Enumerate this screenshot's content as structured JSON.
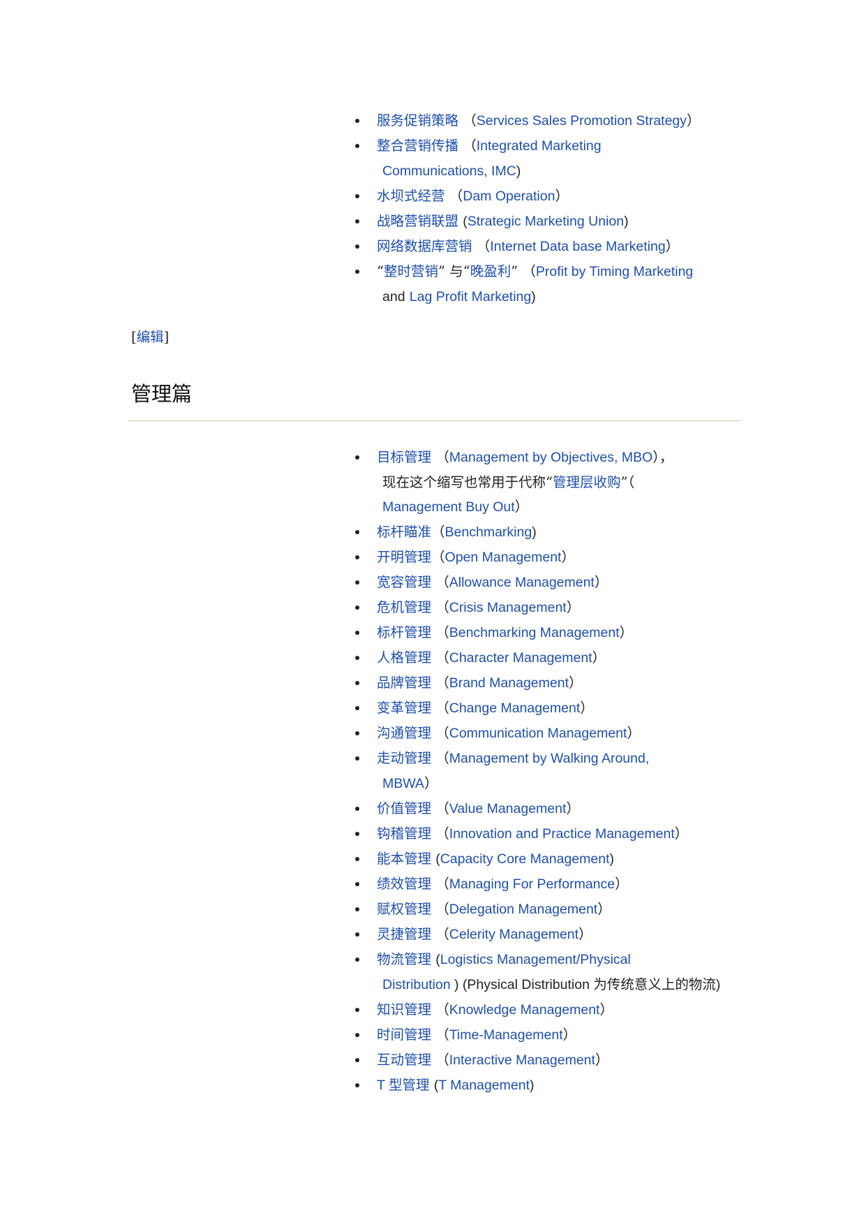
{
  "marketing_items": [
    {
      "zh": "服务促销策略",
      "sep": "（",
      "en": "Services Sales Promotion Strategy",
      "close": "）"
    },
    {
      "zh": "整合营销传播",
      "sep": "（",
      "en": "Integrated Marketing",
      "en2": "Communications, IMC",
      "close": ")"
    },
    {
      "zh": "水坝式经营",
      "sep": "（",
      "en": "Dam Operation",
      "close": "）"
    },
    {
      "zh": "战略营销联盟",
      "sep": "(",
      "en": "Strategic Marketing Union",
      "close": ")"
    },
    {
      "zh": "网络数据库营销",
      "sep": "（",
      "en": "Internet Data base Marketing",
      "close": "）"
    },
    {
      "q1": "“",
      "zh": "整时营销",
      "q2": "” 与“",
      "zh2": "晚盈利",
      "q3": "”",
      "sep": "（",
      "en": "Profit by Timing Marketing",
      "and": "and",
      "en2": "Lag Profit Marketing",
      "close": ")"
    }
  ],
  "edit": {
    "open": "[",
    "label": "编辑",
    "close": "]"
  },
  "section": {
    "title": "管理篇"
  },
  "management_items": [
    {
      "zh": "目标管理",
      "sep": "（",
      "en": "Management by Objectives, MBO",
      "close": "），",
      "tail1": "现在这个缩写也常用于代称“",
      "zh2": "管理层收购",
      "tail2": "”（",
      "en2": "Management Buy Out",
      "close2": "）"
    },
    {
      "zh": "标杆瞄准",
      "sep": "（",
      "en": "Benchmarking",
      "close": ")"
    },
    {
      "zh": "开明管理",
      "sep": "（",
      "en": "Open Management",
      "close": "）"
    },
    {
      "zh": "宽容管理",
      "sep": "（",
      "en": "Allowance Management",
      "close": "）"
    },
    {
      "zh": "危机管理",
      "sep": "（",
      "en": "Crisis Management",
      "close": "）"
    },
    {
      "zh": "标杆管理",
      "sep": "（",
      "en": "Benchmarking Management",
      "close": "）"
    },
    {
      "zh": "人格管理",
      "sep": "（",
      "en": "Character Management",
      "close": "）"
    },
    {
      "zh": "品牌管理",
      "sep": "（",
      "en": "Brand Management",
      "close": "）"
    },
    {
      "zh": "变革管理",
      "sep": "（",
      "en": "Change Management",
      "close": "）"
    },
    {
      "zh": "沟通管理",
      "sep": "（",
      "en": "Communication Management",
      "close": "）"
    },
    {
      "zh": "走动管理",
      "sep": "（",
      "en": "Management by Walking Around,",
      "en2": "MBWA",
      "close": "）"
    },
    {
      "zh": "价值管理",
      "sep": "（",
      "en": "Value Management",
      "close": "）"
    },
    {
      "zh": "钩稽管理",
      "sep": "（",
      "en": "Innovation and Practice Management",
      "close": "）"
    },
    {
      "zh": "能本管理",
      "sep": "(",
      "en": "Capacity Core Management",
      "close": ")"
    },
    {
      "zh": "绩效管理",
      "sep": "（",
      "en": "Managing For Performance",
      "close": "）"
    },
    {
      "zh": "赋权管理",
      "sep": "（",
      "en": "Delegation Management",
      "close": "）"
    },
    {
      "zh": "灵捷管理",
      "sep": "（",
      "en": "Celerity Management",
      "close": "）"
    },
    {
      "zh": "物流管理",
      "sep": "(",
      "en": "Logistics Management/Physical",
      "en2": "Distribution",
      "mid": " ) (Physical Distribution ",
      "zhtail": "为传统意义上的物流",
      "close": ")"
    },
    {
      "zh": "知识管理",
      "sep": "（",
      "en": "Knowledge Management",
      "close": "）"
    },
    {
      "zh": "时间管理",
      "sep": "（",
      "en": "Time-Management",
      "close": "）"
    },
    {
      "zh": "互动管理",
      "sep": "（",
      "en": "Interactive Management",
      "close": "）"
    },
    {
      "pre": "T ",
      "zh": "型管理",
      "sep": "(",
      "en": "T Management",
      "close": ")"
    }
  ]
}
